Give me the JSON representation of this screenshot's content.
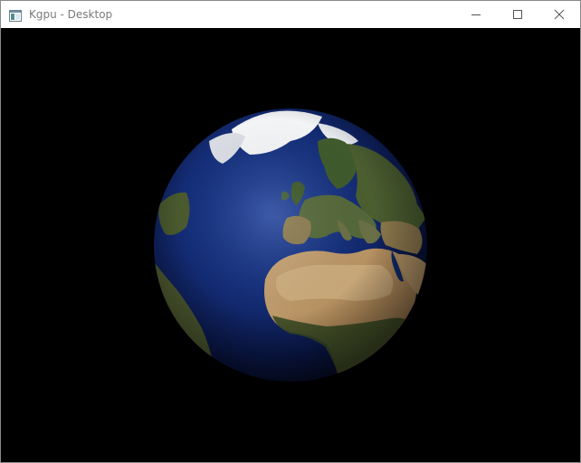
{
  "window": {
    "title": "Kgpu - Desktop"
  },
  "titlebar_buttons": [
    {
      "name": "minimize",
      "icon": "minimize-icon"
    },
    {
      "name": "maximize",
      "icon": "maximize-icon"
    },
    {
      "name": "close",
      "icon": "close-icon"
    }
  ],
  "viewport": {
    "background": "#000000",
    "content": "earth-globe"
  },
  "colors": {
    "ocean": "#0b1a5c",
    "land": "#7d6a45",
    "ice": "#ffffff"
  }
}
